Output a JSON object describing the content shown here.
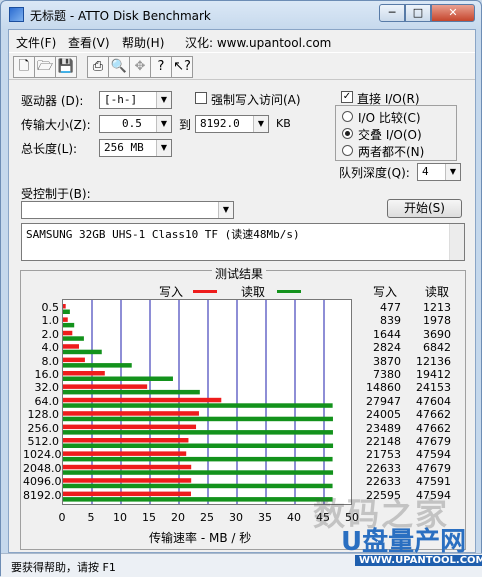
{
  "window": {
    "title": "无标题 - ATTO Disk Benchmark",
    "minimize": "─",
    "maximize": "□",
    "close": "✕"
  },
  "menu": [
    "文件(F)",
    "查看(V)",
    "帮助(H)",
    "汉化: www.upantool.com"
  ],
  "toolbar": [
    "new-icon",
    "open-icon",
    "save-icon",
    "print-icon",
    "print-preview-icon",
    "move-icon",
    "help-icon",
    "context-help-icon"
  ],
  "form": {
    "drive_label": "驱动器 (D):",
    "drive_value": "[-h-]",
    "force_write_label": "强制写入访问(A)",
    "transfer_label": "传输大小(Z):",
    "transfer_from": "0.5",
    "to_label": "到",
    "transfer_to": "8192.0",
    "kb_label": "KB",
    "length_label": "总长度(L):",
    "length_value": "256 MB",
    "direct_io_label": "直接 I/O(R)",
    "direct_io_checked": true,
    "io_compare_label": "I/O 比较(C)",
    "overlapped_io_label": "交叠 I/O(O)",
    "neither_label": "两者都不(N)",
    "selected_io": "overlapped",
    "queue_label": "队列深度(Q):",
    "queue_value": "4",
    "controlled_label": "受控制于(B):",
    "controlled_value": "",
    "start_button": "开始(S)",
    "description": "SAMSUNG 32GB UHS-1 Class10 TF (读速48Mb/s)"
  },
  "results": {
    "title": "测试结果",
    "write_legend": "写入",
    "read_legend": "读取",
    "write_header": "写入",
    "read_header": "读取",
    "xlabel": "传输速率 - MB / 秒",
    "write_color": "#ee1c1c",
    "read_color": "#13921c",
    "grid_color": "#1d1dad"
  },
  "chart_data": {
    "type": "bar",
    "orientation": "horizontal",
    "categories": [
      "0.5",
      "1.0",
      "2.0",
      "4.0",
      "8.0",
      "16.0",
      "32.0",
      "64.0",
      "128.0",
      "256.0",
      "512.0",
      "1024.0",
      "2048.0",
      "4096.0",
      "8192.0"
    ],
    "series": [
      {
        "name": "写入",
        "values": [
          477,
          839,
          1644,
          2824,
          3870,
          7380,
          14860,
          27947,
          24005,
          23489,
          22148,
          21753,
          22633,
          22633,
          22595
        ]
      },
      {
        "name": "读取",
        "values": [
          1213,
          1978,
          3690,
          6842,
          12136,
          19412,
          24153,
          47604,
          47662,
          47662,
          47679,
          47594,
          47679,
          47591,
          47594
        ]
      }
    ],
    "x_ticks": [
      "0",
      "5",
      "10",
      "15",
      "20",
      "25",
      "30",
      "35",
      "40",
      "45",
      "50"
    ],
    "xlim": [
      0,
      50
    ],
    "xlabel": "传输速率 - MB / 秒",
    "grid": true,
    "legend": "top"
  },
  "watermark": {
    "text": "数码之家",
    "sub": "U盘量产网",
    "url": "WWW.UPANTOOL.COM"
  },
  "status": "要获得帮助，请按 F1"
}
